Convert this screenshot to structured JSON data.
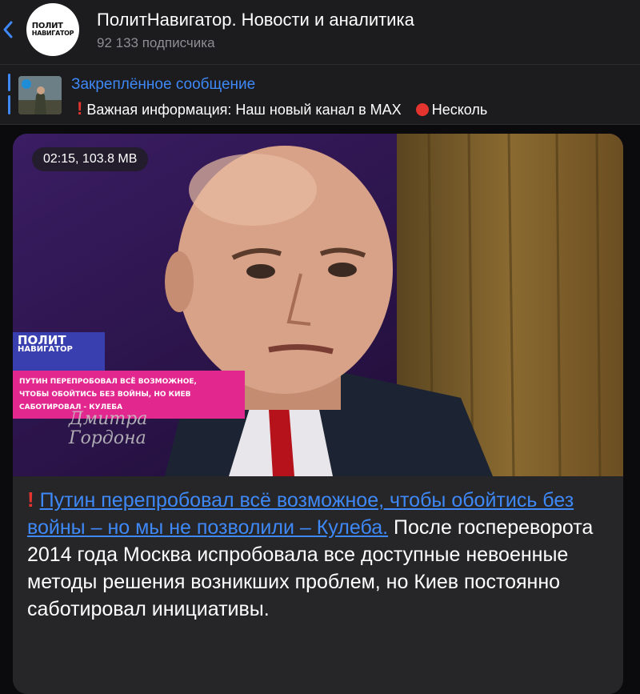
{
  "header": {
    "title": "ПолитНавигатор. Новости и аналитика",
    "subtitle": "92 133 подписчика",
    "avatar_logo_line1": "ПОЛИТ",
    "avatar_logo_line2": "НАВИГАТОР"
  },
  "pinned": {
    "title": "Закреплённое сообщение",
    "text": "Важная информация: Наш новый канал в MAX",
    "text2": "Несколь"
  },
  "message": {
    "media_badge": "02:15, 103.8 MB",
    "overlay_logo_line1": "ПОЛИТ",
    "overlay_logo_line2": "НАВИГАТОР",
    "overlay_caption_line1": "ПУТИН ПЕРЕПРОБОВАЛ ВСЁ ВОЗМОЖНОЕ,",
    "overlay_caption_line2": "ЧТОБЫ ОБОЙТИСЬ БЕЗ ВОЙНЫ, НО КИЕВ",
    "overlay_caption_line3": "САБОТИРОВАЛ - КУЛЕБА",
    "overlay_script_line1": "Дмитра",
    "overlay_script_line2": "Гордона",
    "link_text": "Путин перепробовал всё возможное, чтобы обойтись без войны – но мы не позволили – Кулеба.",
    "body_text": " После госпереворота 2014 года Москва испробовала все доступные невоенные методы решения возникших проблем, но Киев постоянно саботировал инициативы."
  },
  "colors": {
    "accent": "#3e88f7",
    "alert": "#e3342f",
    "overlay_pink": "#e2288f"
  },
  "icons": [
    "back-chevron-icon",
    "exclamation-icon",
    "red-circle-icon"
  ]
}
